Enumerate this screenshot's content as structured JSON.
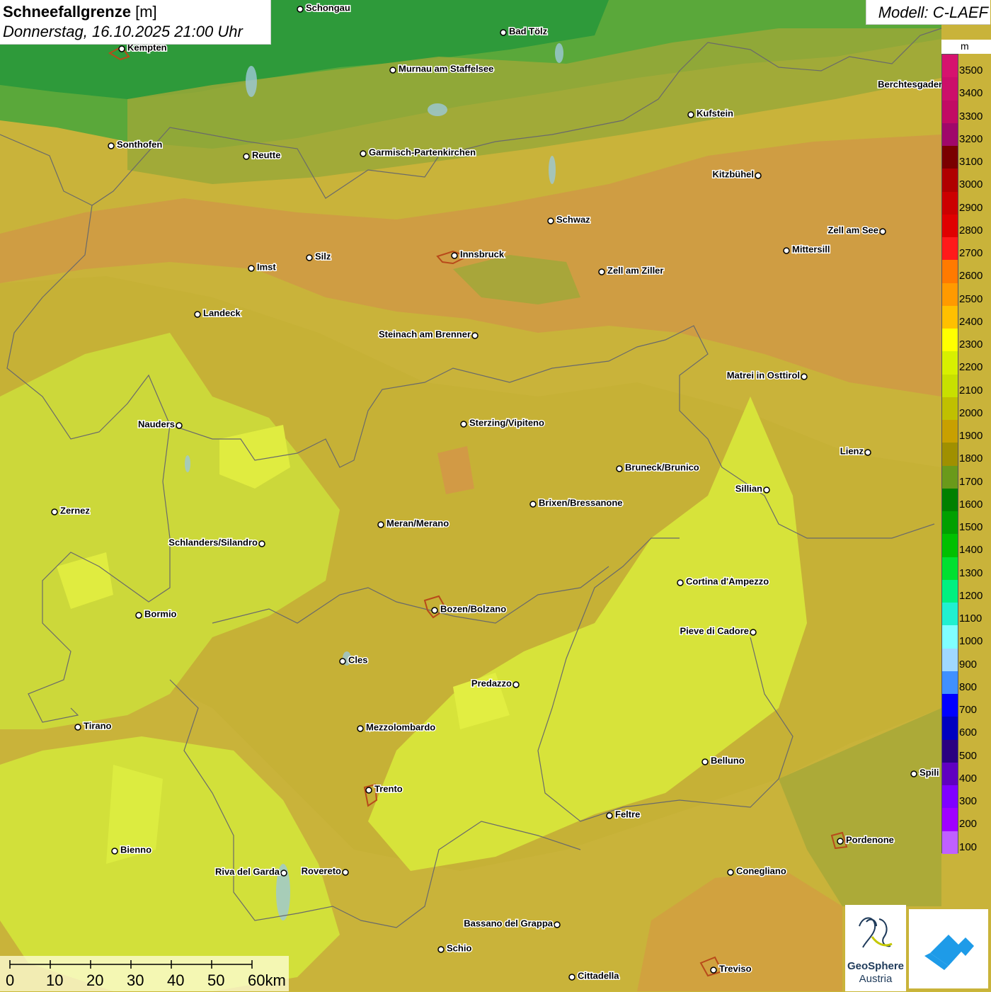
{
  "title": {
    "parameter": "Schneefallgrenze",
    "unit": "[m]",
    "datetime": "Donnerstag, 16.10.2025 21:00 Uhr"
  },
  "model": "Modell: C-LAEF",
  "legend": {
    "unit": "m",
    "labels": [
      "3500",
      "3400",
      "3300",
      "3200",
      "3100",
      "3000",
      "2900",
      "2800",
      "2700",
      "2600",
      "2500",
      "2400",
      "2300",
      "2200",
      "2100",
      "2000",
      "1900",
      "1800",
      "1700",
      "1600",
      "1500",
      "1400",
      "1300",
      "1200",
      "1100",
      "1000",
      "900",
      "800",
      "700",
      "600",
      "500",
      "400",
      "300",
      "200",
      "100"
    ],
    "colors": [
      "#d6136e",
      "#cc0e6a",
      "#c20a64",
      "#a0076a",
      "#7a0000",
      "#b00000",
      "#cc0000",
      "#e00000",
      "#ff1a1a",
      "#ff7a00",
      "#ff9a00",
      "#ffc000",
      "#ffff00",
      "#d8f000",
      "#c8e000",
      "#c0c000",
      "#c8a000",
      "#a09000",
      "#6a9a1a",
      "#008000",
      "#00a000",
      "#00c000",
      "#00e030",
      "#00f080",
      "#20f0d0",
      "#80ffff",
      "#a0d8ff",
      "#4090ff",
      "#0000ff",
      "#0000c0",
      "#2a0080",
      "#6000c0",
      "#8000ff",
      "#a000ff",
      "#c060ff"
    ]
  },
  "cities": [
    {
      "name": "Schongau"
    },
    {
      "name": "Bad Tölz"
    },
    {
      "name": "Kempten"
    },
    {
      "name": "Murnau am Staffelsee"
    },
    {
      "name": "Berchtesgaden"
    },
    {
      "name": "Kufstein"
    },
    {
      "name": "Sonthofen"
    },
    {
      "name": "Reutte"
    },
    {
      "name": "Garmisch-Partenkirchen"
    },
    {
      "name": "Kitzbühel"
    },
    {
      "name": "Schwaz"
    },
    {
      "name": "Zell am See"
    },
    {
      "name": "Mittersill"
    },
    {
      "name": "Imst"
    },
    {
      "name": "Silz"
    },
    {
      "name": "Innsbruck"
    },
    {
      "name": "Zell am Ziller"
    },
    {
      "name": "Landeck"
    },
    {
      "name": "Steinach am Brenner"
    },
    {
      "name": "Matrei in Osttirol"
    },
    {
      "name": "Nauders"
    },
    {
      "name": "Sterzing/Vipiteno"
    },
    {
      "name": "Lienz"
    },
    {
      "name": "Bruneck/Brunico"
    },
    {
      "name": "Sillian"
    },
    {
      "name": "Zernez"
    },
    {
      "name": "Brixen/Bressanone"
    },
    {
      "name": "Meran/Merano"
    },
    {
      "name": "Schlanders/Silandro"
    },
    {
      "name": "Cortina d'Ampezzo"
    },
    {
      "name": "Bozen/Bolzano"
    },
    {
      "name": "Bormio"
    },
    {
      "name": "Pieve di Cadore"
    },
    {
      "name": "Cles"
    },
    {
      "name": "Predazzo"
    },
    {
      "name": "Tirano"
    },
    {
      "name": "Mezzolombardo"
    },
    {
      "name": "Belluno"
    },
    {
      "name": "Spili"
    },
    {
      "name": "Trento"
    },
    {
      "name": "Feltre"
    },
    {
      "name": "Pordenone"
    },
    {
      "name": "Bienno"
    },
    {
      "name": "Riva del Garda"
    },
    {
      "name": "Rovereto"
    },
    {
      "name": "Conegliano"
    },
    {
      "name": "Bassano del Grappa"
    },
    {
      "name": "Schio"
    },
    {
      "name": "Treviso"
    },
    {
      "name": "Cittadella"
    }
  ],
  "scalebar": {
    "labels": [
      "0",
      "10",
      "20",
      "30",
      "40",
      "50",
      "60km"
    ]
  },
  "logos": {
    "geosphere_line1": "GeoSphere",
    "geosphere_line2": "Austria"
  },
  "colors": {
    "field_low_north": "#3aa030",
    "field_mid": "#c8a830",
    "field_yellow": "#d0e030",
    "field_orange": "#d29a40"
  }
}
